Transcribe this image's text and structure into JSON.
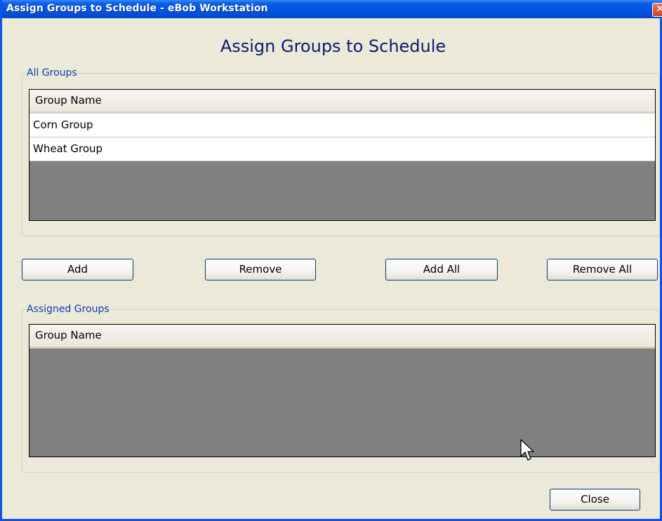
{
  "window": {
    "title": "Assign Groups to Schedule - eBob Workstation",
    "close_glyph": "✕"
  },
  "heading": "Assign Groups to Schedule",
  "all_groups": {
    "legend": "All Groups",
    "column_header": "Group Name",
    "rows": [
      "Corn Group",
      "Wheat Group"
    ]
  },
  "buttons": {
    "add": "Add",
    "remove": "Remove",
    "add_all": "Add All",
    "remove_all": "Remove All",
    "close": "Close"
  },
  "assigned_groups": {
    "legend": "Assigned Groups",
    "column_header": "Group Name",
    "rows": []
  },
  "colors": {
    "titlebar": "#0054e3",
    "window_bg": "#ece9d8",
    "grid_empty": "#808080",
    "heading": "#0a1a6e",
    "legend": "#0d3db5"
  },
  "icons": {
    "close": "close-icon",
    "cursor": "mouse-cursor-icon"
  }
}
